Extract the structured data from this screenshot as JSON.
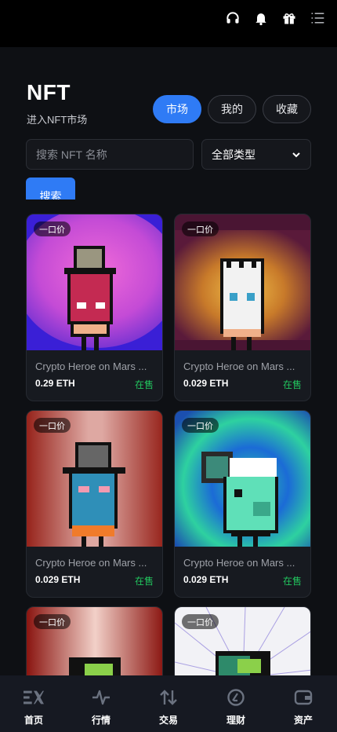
{
  "topbar": {
    "icons": [
      "headset-icon",
      "notification-bell-icon",
      "gift-icon",
      "menu-icon"
    ]
  },
  "header": {
    "title": "NFT",
    "subtitle": "进入NFT市场"
  },
  "tabs": [
    {
      "label": "市场",
      "active": true
    },
    {
      "label": "我的"
    },
    {
      "label": "收藏"
    }
  ],
  "search": {
    "placeholder": "搜索 NFT 名称",
    "button_label": "搜索"
  },
  "filter": {
    "selected": "全部类型"
  },
  "colors": {
    "accent": "#2f7bf5",
    "status_green": "#22c55e",
    "background": "#0e1014"
  },
  "cards": [
    {
      "badge": "一口价",
      "name": "Crypto Heroe on Mars ...",
      "price": "0.29 ETH",
      "status": "在售"
    },
    {
      "badge": "一口价",
      "name": "Crypto Heroe on Mars ...",
      "price": "0.029 ETH",
      "status": "在售"
    },
    {
      "badge": "一口价",
      "name": "Crypto Heroe on Mars ...",
      "price": "0.029 ETH",
      "status": "在售"
    },
    {
      "badge": "一口价",
      "name": "Crypto Heroe on Mars ...",
      "price": "0.029 ETH",
      "status": "在售"
    },
    {
      "badge": "一口价",
      "name": "",
      "price": "",
      "status": ""
    },
    {
      "badge": "一口价",
      "name": "",
      "price": "",
      "status": ""
    }
  ],
  "bottom_nav": [
    {
      "label": "首页",
      "icon": "home-logo-icon"
    },
    {
      "label": "行情",
      "icon": "market-pulse-icon"
    },
    {
      "label": "交易",
      "icon": "trade-arrows-icon"
    },
    {
      "label": "理财",
      "icon": "finance-icon"
    },
    {
      "label": "资产",
      "icon": "wallet-icon"
    }
  ]
}
